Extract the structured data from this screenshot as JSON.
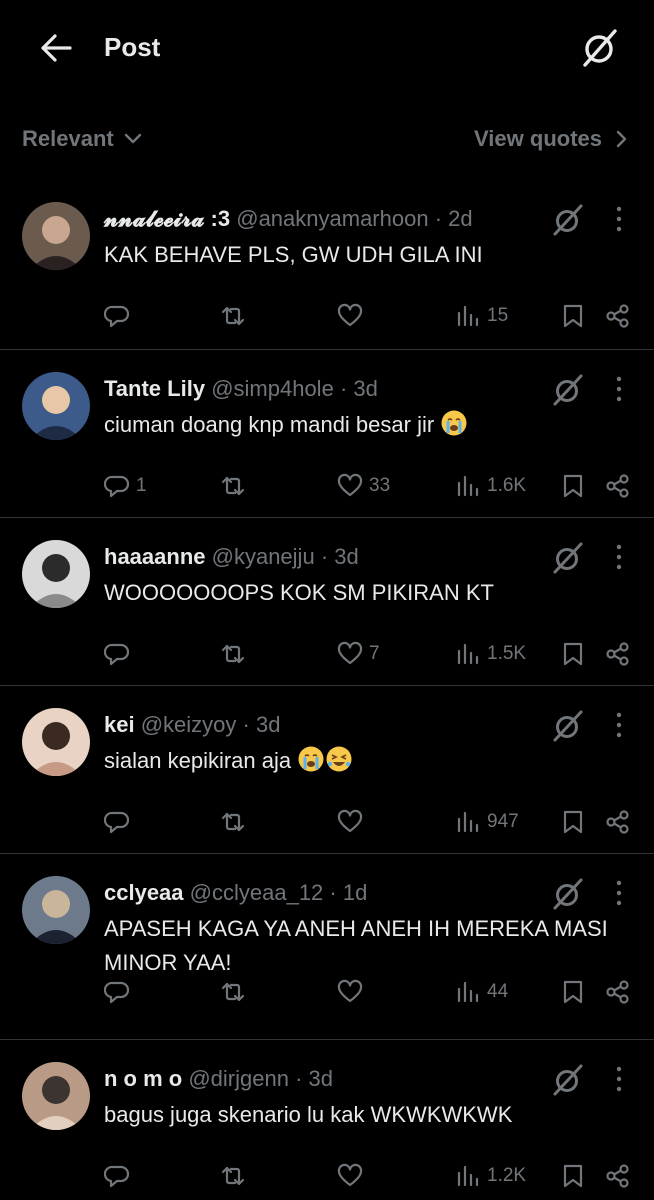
{
  "header": {
    "title": "Post"
  },
  "filter": {
    "sort_label": "Relevant",
    "view_quotes_label": "View quotes"
  },
  "replies": [
    {
      "name": "𝓷𝓷𝓪𝓵𝓮𝓮𝓲𝓻𝓪 :3",
      "handle": "@anaknyamarhoon",
      "time": "2d",
      "text": "KAK BEHAVE PLS, GW UDH GILA INI",
      "replies_count": "",
      "likes": "",
      "views": "15"
    },
    {
      "name": "Tante Lily",
      "handle": "@simp4hole",
      "time": "3d",
      "text": "ciuman doang knp mandi besar jir",
      "replies_count": "1",
      "likes": "33",
      "views": "1.6K"
    },
    {
      "name": "haaaanne",
      "handle": "@kyanejju",
      "time": "3d",
      "text": "WOOOOOOOPS KOK SM PIKIRAN KT",
      "replies_count": "",
      "likes": "7",
      "views": "1.5K"
    },
    {
      "name": "kei",
      "handle": "@keizyoy",
      "time": "3d",
      "text": "sialan kepikiran aja",
      "replies_count": "",
      "likes": "",
      "views": "947"
    },
    {
      "name": "cclyeaa",
      "handle": "@cclyeaa_12",
      "time": "1d",
      "text": "APASEH KAGA YA ANEH ANEH IH MEREKA MASI MINOR YAA!",
      "replies_count": "",
      "likes": "",
      "views": "44"
    },
    {
      "name": "n o m o",
      "handle": "@dirjgenn",
      "time": "3d",
      "text": "bagus juga skenario lu kak WKWKWKWK",
      "replies_count": "",
      "likes": "",
      "views": "1.2K"
    }
  ],
  "colors": {
    "background": "#000000",
    "text": "#e7e9ea",
    "muted": "#71767b",
    "divider": "#2f3336"
  }
}
